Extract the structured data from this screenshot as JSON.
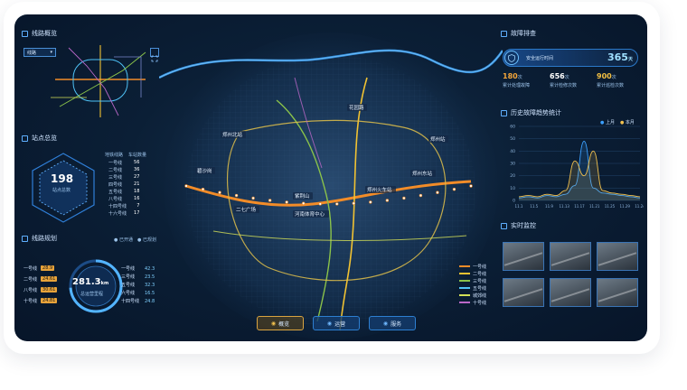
{
  "left": {
    "line_overview": {
      "title": "线路概览",
      "dropdown": "线路",
      "dropdown_arrow": "▾"
    },
    "station_overview": {
      "title": "站点总览",
      "total": "198",
      "total_label": "站点总数",
      "col_line": "地铁线路",
      "col_count": "车站数量",
      "rows": [
        {
          "name": "一号线",
          "count": "56"
        },
        {
          "name": "二号线",
          "count": "36"
        },
        {
          "name": "三号线",
          "count": "27"
        },
        {
          "name": "四号线",
          "count": "21"
        },
        {
          "name": "五号线",
          "count": "18"
        },
        {
          "name": "八号线",
          "count": "16"
        },
        {
          "name": "十四号线",
          "count": "7"
        },
        {
          "name": "十六号线",
          "count": "17"
        }
      ]
    },
    "line_plan": {
      "title": "线路规划",
      "legend_open": "已开通",
      "legend_plan": "已规划",
      "total": "281.3",
      "unit": "km",
      "total_label": "总运营里程",
      "left_items": [
        {
          "name": "一号线",
          "value": "28.9",
          "color": "#e8a33a"
        },
        {
          "name": "二号线",
          "value": "24.61",
          "color": "#e8a33a"
        },
        {
          "name": "八号线",
          "value": "30.61",
          "color": "#e8a33a"
        },
        {
          "name": "十号线",
          "value": "24.81",
          "color": "#e8a33a"
        }
      ],
      "right_items": [
        {
          "name": "一号线",
          "value": "42.3"
        },
        {
          "name": "三号线",
          "value": "23.5"
        },
        {
          "name": "五号线",
          "value": "32.3"
        },
        {
          "name": "六号线",
          "value": "16.5"
        },
        {
          "name": "十四号线",
          "value": "24.8"
        }
      ]
    }
  },
  "map": {
    "labels": [
      "碧沙岗",
      "二七广场",
      "紫荆山",
      "郑州东站",
      "郑州火车站",
      "河南体育中心",
      "郑州北站",
      "花园路",
      "郑州站"
    ],
    "legend": [
      {
        "name": "一号线",
        "color": "#f28c28"
      },
      {
        "name": "二号线",
        "color": "#f1c232"
      },
      {
        "name": "三号线",
        "color": "#8bc34a"
      },
      {
        "name": "五号线",
        "color": "#4fc3f7"
      },
      {
        "name": "城郊线",
        "color": "#d4e157"
      },
      {
        "name": "十号线",
        "color": "#ba68c8"
      }
    ]
  },
  "right": {
    "fault": {
      "title": "故障排查",
      "safe_label": "安全运行时间",
      "safe_days": "365",
      "safe_unit": "天",
      "stats": [
        {
          "value": "180",
          "unit": "次",
          "label": "累计处理故障",
          "color": "#f4a63a"
        },
        {
          "value": "656",
          "unit": "次",
          "label": "累计检修次数",
          "color": "#ffffff"
        },
        {
          "value": "900",
          "unit": "次",
          "label": "累计巡检次数",
          "color": "#f4c042"
        }
      ]
    },
    "trend": {
      "title": "历史故障趋势统计",
      "legend": [
        {
          "name": "上月",
          "color": "#3ba0ff"
        },
        {
          "name": "本月",
          "color": "#f2c14e"
        }
      ]
    },
    "monitor": {
      "title": "实时监控"
    }
  },
  "nav": [
    {
      "label": "概览",
      "active": true
    },
    {
      "label": "运营",
      "active": false
    },
    {
      "label": "服务",
      "active": false
    }
  ],
  "chart_data": {
    "type": "line",
    "title": "历史故障趋势统计",
    "x": [
      "11.1",
      "11.5",
      "11.9",
      "11.13",
      "11.17",
      "11.21",
      "11.25",
      "11.29",
      "11.24"
    ],
    "ylim": [
      0,
      60
    ],
    "yticks": [
      0,
      10,
      20,
      30,
      40,
      50,
      60
    ],
    "series": [
      {
        "name": "上月",
        "color": "#3ba0ff",
        "values": [
          2,
          3,
          2,
          4,
          3,
          5,
          12,
          48,
          10,
          6,
          5,
          4,
          3,
          2
        ]
      },
      {
        "name": "本月",
        "color": "#f2c14e",
        "values": [
          3,
          4,
          3,
          5,
          4,
          8,
          32,
          20,
          40,
          8,
          6,
          5,
          4,
          3
        ]
      }
    ]
  }
}
